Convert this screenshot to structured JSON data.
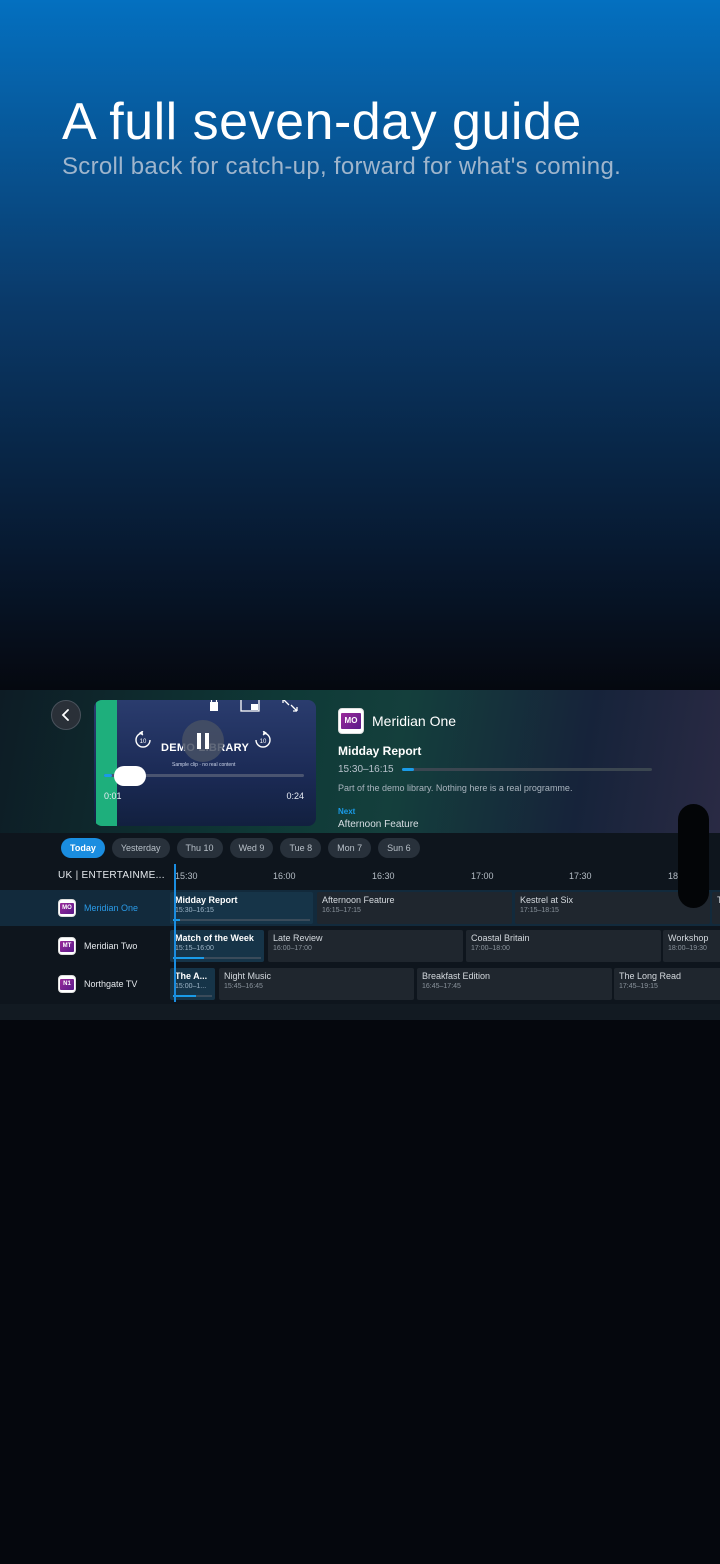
{
  "hero": {
    "title": "A full seven-day guide",
    "subtitle": "Scroll back for catch-up, forward for what's coming."
  },
  "colors": {
    "accent": "#1a8de0",
    "player_bar": "#1eaf7c"
  },
  "player": {
    "title": "DEMO LIBRARY",
    "caption": "Sample clip · no real content",
    "skip_back": "10",
    "skip_forward": "10",
    "elapsed": "0:01",
    "duration": "0:24",
    "progress": 0.04
  },
  "info": {
    "logo": "MO",
    "channel": "Meridian One",
    "programme": "Midday Report",
    "time": "15:30–16:15",
    "progress": 0.05,
    "description": "Part of the demo library. Nothing here is a real programme.",
    "next_label": "Next",
    "next": "Afternoon Feature"
  },
  "days": [
    "Today",
    "Yesterday",
    "Thu 10",
    "Wed 9",
    "Tue 8",
    "Mon 7",
    "Sun 6"
  ],
  "grid": {
    "category": "UK | ENTERTAINME...",
    "ticks": [
      "15:30",
      "16:00",
      "16:30",
      "17:00",
      "17:30",
      "18"
    ],
    "rows": [
      {
        "logo": "MO",
        "channel": "Meridian One",
        "programmes": [
          {
            "title": "Midday Report",
            "time": "15:30–16:15",
            "progress": 0.05
          },
          {
            "title": "Afternoon Feature",
            "time": "16:15–17:15"
          },
          {
            "title": "Kestrel at Six",
            "time": "17:15–18:15"
          },
          {
            "title": "T",
            "time": ""
          }
        ]
      },
      {
        "logo": "MT",
        "channel": "Meridian Two",
        "programmes": [
          {
            "title": "Match of the Week",
            "time": "15:15–16:00",
            "progress": 0.35
          },
          {
            "title": "Late Review",
            "time": "16:00–17:00"
          },
          {
            "title": "Coastal Britain",
            "time": "17:00–18:00"
          },
          {
            "title": "Workshop",
            "time": "18:00–19:30"
          }
        ]
      },
      {
        "logo": "N1",
        "channel": "Northgate TV",
        "programmes": [
          {
            "title": "The A...",
            "time": "15:00–1...",
            "progress": 0.6
          },
          {
            "title": "Night Music",
            "time": "15:45–16:45"
          },
          {
            "title": "Breakfast Edition",
            "time": "16:45–17:45"
          },
          {
            "title": "The Long Read",
            "time": "17:45–19:15"
          }
        ]
      }
    ]
  }
}
